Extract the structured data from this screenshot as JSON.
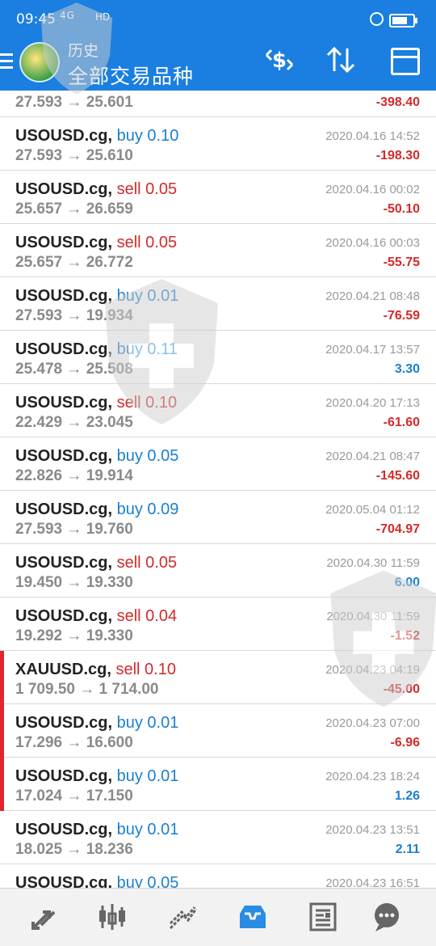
{
  "status_bar": {
    "time": "09:45",
    "signal": "4G",
    "network": "HD",
    "icons": [
      "alarm-icon",
      "battery-icon"
    ]
  },
  "header": {
    "subtitle": "历史",
    "title": "全部交易品种",
    "actions": [
      "currency-swap-icon",
      "sort-icon",
      "calendar-icon"
    ]
  },
  "rows": [
    {
      "symbol": "",
      "side": "",
      "lot": "",
      "open_price": "27.593",
      "close_price": "25.601",
      "date": "",
      "profit": "-398.40",
      "profit_sign": "neg",
      "mark": false
    },
    {
      "symbol": "USOUSD.cg,",
      "side": "buy",
      "lot": "0.10",
      "open_price": "27.593",
      "close_price": "25.610",
      "date": "2020.04.16 14:52",
      "profit": "-198.30",
      "profit_sign": "neg",
      "mark": false
    },
    {
      "symbol": "USOUSD.cg,",
      "side": "sell",
      "lot": "0.05",
      "open_price": "25.657",
      "close_price": "26.659",
      "date": "2020.04.16 00:02",
      "profit": "-50.10",
      "profit_sign": "neg",
      "mark": false
    },
    {
      "symbol": "USOUSD.cg,",
      "side": "sell",
      "lot": "0.05",
      "open_price": "25.657",
      "close_price": "26.772",
      "date": "2020.04.16 00:03",
      "profit": "-55.75",
      "profit_sign": "neg",
      "mark": false
    },
    {
      "symbol": "USOUSD.cg,",
      "side": "buy",
      "lot": "0.01",
      "open_price": "27.593",
      "close_price": "19.934",
      "date": "2020.04.21 08:48",
      "profit": "-76.59",
      "profit_sign": "neg",
      "mark": false
    },
    {
      "symbol": "USOUSD.cg,",
      "side": "buy",
      "lot": "0.11",
      "open_price": "25.478",
      "close_price": "25.508",
      "date": "2020.04.17 13:57",
      "profit": "3.30",
      "profit_sign": "pos",
      "mark": false
    },
    {
      "symbol": "USOUSD.cg,",
      "side": "sell",
      "lot": "0.10",
      "open_price": "22.429",
      "close_price": "23.045",
      "date": "2020.04.20 17:13",
      "profit": "-61.60",
      "profit_sign": "neg",
      "mark": false
    },
    {
      "symbol": "USOUSD.cg,",
      "side": "buy",
      "lot": "0.05",
      "open_price": "22.826",
      "close_price": "19.914",
      "date": "2020.04.21 08:47",
      "profit": "-145.60",
      "profit_sign": "neg",
      "mark": false
    },
    {
      "symbol": "USOUSD.cg,",
      "side": "buy",
      "lot": "0.09",
      "open_price": "27.593",
      "close_price": "19.760",
      "date": "2020.05.04 01:12",
      "profit": "-704.97",
      "profit_sign": "neg",
      "mark": false
    },
    {
      "symbol": "USOUSD.cg,",
      "side": "sell",
      "lot": "0.05",
      "open_price": "19.450",
      "close_price": "19.330",
      "date": "2020.04.30 11:59",
      "profit": "6.00",
      "profit_sign": "pos",
      "mark": false
    },
    {
      "symbol": "USOUSD.cg,",
      "side": "sell",
      "lot": "0.04",
      "open_price": "19.292",
      "close_price": "19.330",
      "date": "2020.04.30 11:59",
      "profit": "-1.52",
      "profit_sign": "neg",
      "mark": false
    },
    {
      "symbol": "XAUUSD.cg,",
      "side": "sell",
      "lot": "0.10",
      "open_price": "1 709.50",
      "close_price": "1 714.00",
      "date": "2020.04.23 04:19",
      "profit": "-45.00",
      "profit_sign": "neg",
      "mark": true
    },
    {
      "symbol": "USOUSD.cg,",
      "side": "buy",
      "lot": "0.01",
      "open_price": "17.296",
      "close_price": "16.600",
      "date": "2020.04.23 07:00",
      "profit": "-6.96",
      "profit_sign": "neg",
      "mark": true
    },
    {
      "symbol": "USOUSD.cg,",
      "side": "buy",
      "lot": "0.01",
      "open_price": "17.024",
      "close_price": "17.150",
      "date": "2020.04.23 18:24",
      "profit": "1.26",
      "profit_sign": "pos",
      "mark": true
    },
    {
      "symbol": "USOUSD.cg,",
      "side": "buy",
      "lot": "0.01",
      "open_price": "18.025",
      "close_price": "18.236",
      "date": "2020.04.23 13:51",
      "profit": "2.11",
      "profit_sign": "pos",
      "mark": false
    },
    {
      "symbol": "USOUSD.cg,",
      "side": "buy",
      "lot": "0.05",
      "open_price": "",
      "close_price": "",
      "date": "2020.04.23 16:51",
      "profit": "",
      "profit_sign": "pos",
      "mark": false
    }
  ],
  "arrow": "→",
  "tabbar": {
    "tabs": [
      {
        "icon": "quotes-icon",
        "active": false
      },
      {
        "icon": "chart-icon",
        "active": false
      },
      {
        "icon": "trade-icon",
        "active": false
      },
      {
        "icon": "history-icon",
        "active": true
      },
      {
        "icon": "news-icon",
        "active": false
      },
      {
        "icon": "chat-icon",
        "active": false
      }
    ]
  },
  "colors": {
    "header": "#1a7fe0",
    "buy": "#1a7fd1",
    "sell": "#d32a2a",
    "active_tab": "#2a8de3",
    "inactive_tab": "#666666"
  }
}
